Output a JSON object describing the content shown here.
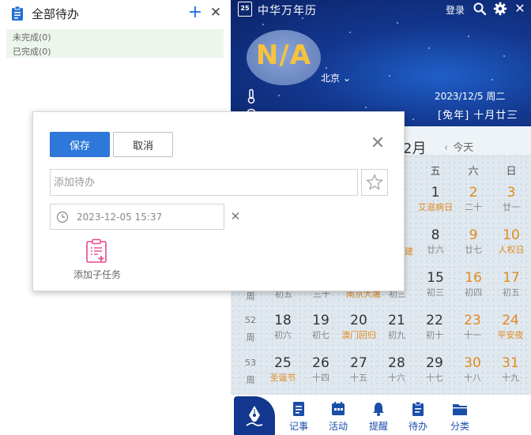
{
  "todo": {
    "title": "全部待办",
    "add_label": "+",
    "close_label": "✕",
    "groups": [
      "未完成(0)",
      "已完成(0)"
    ]
  },
  "app": {
    "title": "中华万年历",
    "logo_text": "25",
    "login": "登录",
    "close_label": "✕"
  },
  "weather": {
    "text": "N/A",
    "city": "北京"
  },
  "today": {
    "solar": "2023/12/5 周二",
    "lunar": "[兔年] 十月廿三"
  },
  "calendar": {
    "month_label": "2月",
    "today_btn": "今天",
    "weekday_headers": [
      "五",
      "六",
      "日"
    ],
    "week_rows": [
      {
        "week": "",
        "label": ""
      },
      {
        "week": "",
        "label": ""
      },
      {
        "week": "",
        "label": "周"
      },
      {
        "week": "52",
        "label": "周"
      },
      {
        "week": "53",
        "label": "周"
      }
    ],
    "partial_row3": [
      "初五",
      "三十",
      "南京大屠",
      "初三"
    ],
    "partial_row2_cut": "建",
    "days": [
      {
        "day": "1",
        "sub": "艾滋病日",
        "type": "festival",
        "weekend": false
      },
      {
        "day": "2",
        "sub": "二十",
        "type": "normal",
        "weekend": true
      },
      {
        "day": "3",
        "sub": "廿一",
        "type": "normal",
        "weekend": true
      },
      {
        "day": "8",
        "sub": "廿六",
        "type": "normal",
        "weekend": false
      },
      {
        "day": "9",
        "sub": "廿七",
        "type": "normal",
        "weekend": true
      },
      {
        "day": "10",
        "sub": "人权日",
        "type": "festival",
        "weekend": true
      },
      {
        "day": "15",
        "sub": "初三",
        "type": "normal",
        "weekend": false
      },
      {
        "day": "16",
        "sub": "初四",
        "type": "normal",
        "weekend": true
      },
      {
        "day": "17",
        "sub": "初五",
        "type": "normal",
        "weekend": true
      },
      {
        "day": "18",
        "sub": "初六",
        "type": "normal",
        "weekend": false
      },
      {
        "day": "19",
        "sub": "初七",
        "type": "normal",
        "weekend": false
      },
      {
        "day": "20",
        "sub": "澳门回归",
        "type": "festival",
        "weekend": false
      },
      {
        "day": "21",
        "sub": "初九",
        "type": "normal",
        "weekend": false
      },
      {
        "day": "22",
        "sub": "初十",
        "type": "normal",
        "weekend": false
      },
      {
        "day": "23",
        "sub": "十一",
        "type": "normal",
        "weekend": true
      },
      {
        "day": "24",
        "sub": "平安夜",
        "type": "festival",
        "weekend": true
      },
      {
        "day": "25",
        "sub": "圣诞节",
        "type": "festival",
        "weekend": false
      },
      {
        "day": "26",
        "sub": "十四",
        "type": "normal",
        "weekend": false
      },
      {
        "day": "27",
        "sub": "十五",
        "type": "normal",
        "weekend": false
      },
      {
        "day": "28",
        "sub": "十六",
        "type": "normal",
        "weekend": false
      },
      {
        "day": "29",
        "sub": "十七",
        "type": "normal",
        "weekend": false
      },
      {
        "day": "30",
        "sub": "十八",
        "type": "normal",
        "weekend": true
      },
      {
        "day": "31",
        "sub": "十九",
        "type": "normal",
        "weekend": true
      }
    ]
  },
  "nav": [
    {
      "label": "记事",
      "icon": "note-icon"
    },
    {
      "label": "活动",
      "icon": "activity-icon"
    },
    {
      "label": "提醒",
      "icon": "bell-icon"
    },
    {
      "label": "待办",
      "icon": "todo-icon"
    },
    {
      "label": "分类",
      "icon": "folder-icon"
    }
  ],
  "dialog": {
    "save_label": "保存",
    "cancel_label": "取消",
    "input_placeholder": "添加待办",
    "input_value": "",
    "datetime": "2023-12-05 15:37",
    "subtask_label": "添加子任务",
    "close_label": "✕",
    "clear_label": "✕"
  },
  "colors": {
    "accent_blue": "#2e78da",
    "header_blue": "#13378e",
    "weekend_orange": "#e08a1e",
    "subtask_pink": "#e8488a"
  }
}
